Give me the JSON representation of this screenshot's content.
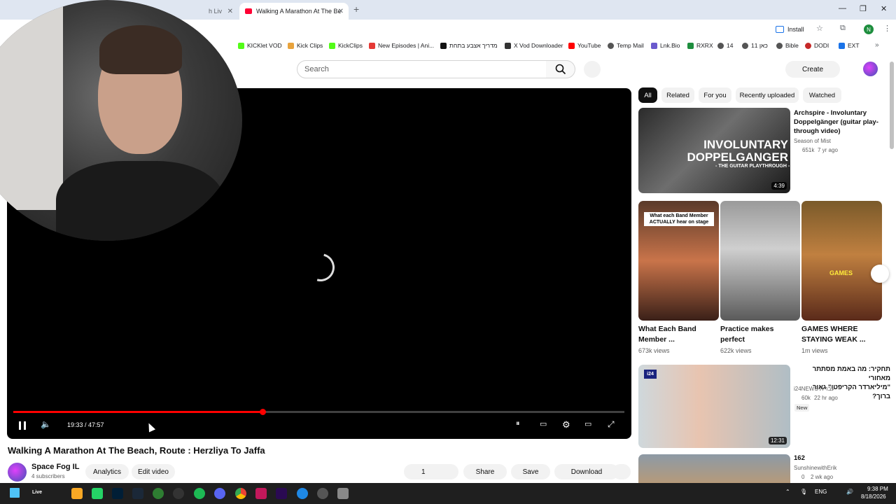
{
  "browser": {
    "tabs": [
      {
        "label": "h Liv"
      },
      {
        "label": "Walking A Marathon At The Be"
      }
    ],
    "new_tab": "+",
    "install_label": "Install",
    "profile_initial": "N",
    "bookmarks": [
      {
        "label": "KICKlet VOD",
        "color": "#53fc18"
      },
      {
        "label": "Kick Clips",
        "color": "#e8a33d"
      },
      {
        "label": "KickClips",
        "color": "#53fc18"
      },
      {
        "label": "New Episodes | Ani...",
        "color": "#e53935"
      },
      {
        "label": "מדריך אצבע בתחת",
        "color": "#111111"
      },
      {
        "label": "X Vod Downloader",
        "color": "#333333"
      },
      {
        "label": "YouTube",
        "color": "#ff0000"
      },
      {
        "label": "Temp Mail",
        "color": "#555555"
      },
      {
        "label": "Lnk.Bio",
        "color": "#6a5acd"
      },
      {
        "label": "RXRX",
        "color": "#1e8e3e"
      },
      {
        "label": "14",
        "color": "#555555"
      },
      {
        "label": "כאן 11",
        "color": "#555555"
      },
      {
        "label": "Bible",
        "color": "#555555"
      },
      {
        "label": "DODI",
        "color": "#c62828"
      },
      {
        "label": "EXT",
        "color": "#1a73e8"
      }
    ]
  },
  "youtube": {
    "search_placeholder": "Search",
    "create_label": "Create",
    "player": {
      "time": "19:33 / 47:57",
      "progress": 0.408
    },
    "video_title": "Walking A Marathon At The Beach, Route : Herzliya To Jaffa",
    "channel": {
      "name": "Space Fog IL",
      "subs": "4 subscribers"
    },
    "actions": {
      "analytics": "Analytics",
      "edit": "Edit video",
      "likes": "1",
      "share": "Share",
      "save": "Save",
      "download": "Download"
    },
    "chips": [
      "All",
      "Related",
      "For you",
      "Recently uploaded",
      "Watched"
    ],
    "rec1": {
      "title_line1": "Archspire - Involuntary",
      "title_line2": "Doppelgänger (guitar play-",
      "title_line3": "through video)",
      "channel": "Season of Mist",
      "views": "651k",
      "age": "7 yr ago",
      "duration": "4:39",
      "thumb_text": "INVOLUNTARY DOPPELGANGER",
      "thumb_sub": "- THE GUITAR PLAYTHROUGH -"
    },
    "shorts": [
      {
        "title1": "What Each Band",
        "title2": "Member ...",
        "views": "673k views",
        "overlay": "What each Band Member ACTUALLY hear on stage"
      },
      {
        "title1": "Practice makes",
        "title2": "perfect",
        "views": "622k views",
        "overlay": ""
      },
      {
        "title1": "GAMES WHERE",
        "title2": "STAYING WEAK ...",
        "views": "1m views",
        "overlay": "GAMES"
      }
    ],
    "rec2": {
      "title_line1": "תחקיר: מה באמת מסתתר מאחורי",
      "title_line2": "\"מיליארדר הקריפטו\" גאור ברוך?",
      "channel": "i24NEWS עברית",
      "views": "60k",
      "age": "22 hr ago",
      "badge": "New",
      "duration": "12:31",
      "logo": "i24"
    },
    "rec3": {
      "title": "162",
      "channel": "SunshinewithErik",
      "views": "0",
      "age": "2 wk ago"
    }
  },
  "taskbar": {
    "live_label": "Live",
    "lang": "ENG",
    "time": "9:38 PM",
    "date": "8/18/2026"
  }
}
